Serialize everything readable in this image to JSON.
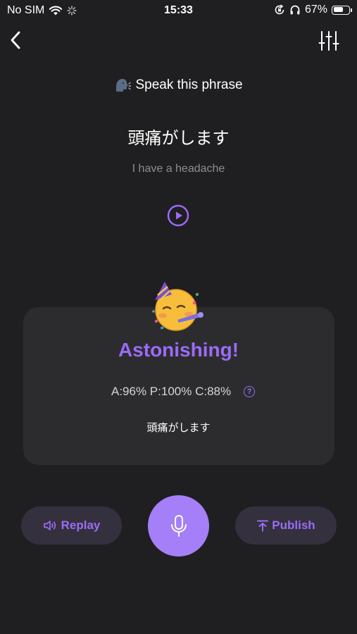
{
  "status_bar": {
    "carrier": "No SIM",
    "time": "15:33",
    "battery_percent": "67%",
    "battery_level": 0.67,
    "icons": [
      "wifi-icon",
      "loading-spinner-icon",
      "orientation-lock-icon",
      "headphones-icon",
      "battery-icon"
    ]
  },
  "nav": {
    "back_icon": "chevron-left-icon",
    "settings_icon": "sliders-icon"
  },
  "prompt": {
    "icon": "speaking-head-emoji",
    "label": "Speak this phrase"
  },
  "phrase": {
    "text": "頭痛がします",
    "translation": "I have a headache",
    "play_icon": "play-circle-icon"
  },
  "result": {
    "emoji": "partying-face-emoji",
    "title": "Astonishing!",
    "scores": "A:96% P:100% C:88%",
    "help_label": "?",
    "recognized_text": "頭痛がします"
  },
  "controls": {
    "replay_label": "Replay",
    "publish_label": "Publish",
    "mic_icon": "microphone-icon"
  },
  "colors": {
    "background": "#1f1f21",
    "card": "#2c2c2f",
    "accent": "#9a6cf6",
    "mic_button": "#a57ff7",
    "pill": "#34303e"
  }
}
